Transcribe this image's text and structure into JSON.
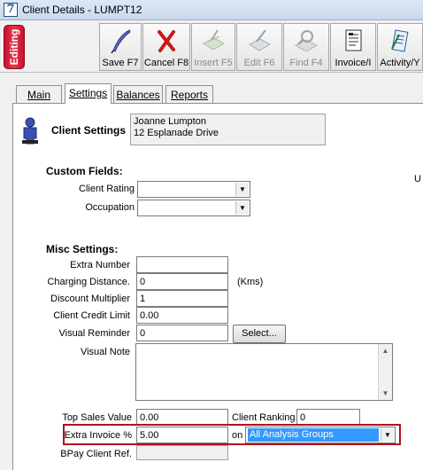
{
  "window": {
    "title": "Client Details - LUMPT12",
    "icon": "7"
  },
  "toolbar": {
    "badge": "Editing",
    "buttons": [
      {
        "label": "Save F7",
        "icon": "quill-icon"
      },
      {
        "label": "Cancel F8",
        "icon": "red-x-icon"
      },
      {
        "label": "Insert F5",
        "icon": "insert-icon"
      },
      {
        "label": "Edit F6",
        "icon": "edit-icon"
      },
      {
        "label": "Find F4",
        "icon": "find-icon"
      },
      {
        "label": "Invoice/I",
        "icon": "invoice-icon"
      },
      {
        "label": "Activity/Y",
        "icon": "activity-icon"
      }
    ]
  },
  "tabs": [
    "Main",
    "Settings",
    "Balances",
    "Reports"
  ],
  "active_tab": "Settings",
  "client": {
    "heading": "Client Settings",
    "name": "Joanne Lumpton",
    "address": "12 Esplanade Drive"
  },
  "custom_fields": {
    "heading": "Custom Fields:",
    "client_rating_label": "Client Rating",
    "client_rating_value": "",
    "occupation_label": "Occupation",
    "occupation_value": ""
  },
  "stray_text": "U",
  "misc": {
    "heading": "Misc Settings:",
    "extra_number_label": "Extra Number",
    "extra_number_value": "",
    "charging_distance_label": "Charging Distance.",
    "charging_distance_value": "0",
    "charging_distance_unit": "(Kms)",
    "discount_multiplier_label": "Discount Multiplier",
    "discount_multiplier_value": "1",
    "credit_limit_label": "Client Credit Limit",
    "credit_limit_value": "0.00",
    "visual_reminder_label": "Visual Reminder",
    "visual_reminder_value": "0",
    "select_button": "Select...",
    "visual_note_label": "Visual Note",
    "visual_note_value": "",
    "top_sales_label": "Top Sales Value",
    "top_sales_value": "0.00",
    "client_ranking_label": "Client Ranking",
    "client_ranking_value": "0",
    "extra_invoice_label": "Extra Invoice %",
    "extra_invoice_value": "5.00",
    "on_label": "on",
    "analysis_group_value": "All Analysis Groups",
    "bpay_label": "BPay Client Ref.",
    "bpay_value": ""
  },
  "colors": {
    "highlight_border": "#b0141e",
    "selection_bg": "#3399ff",
    "badge_red": "#c8102e"
  }
}
